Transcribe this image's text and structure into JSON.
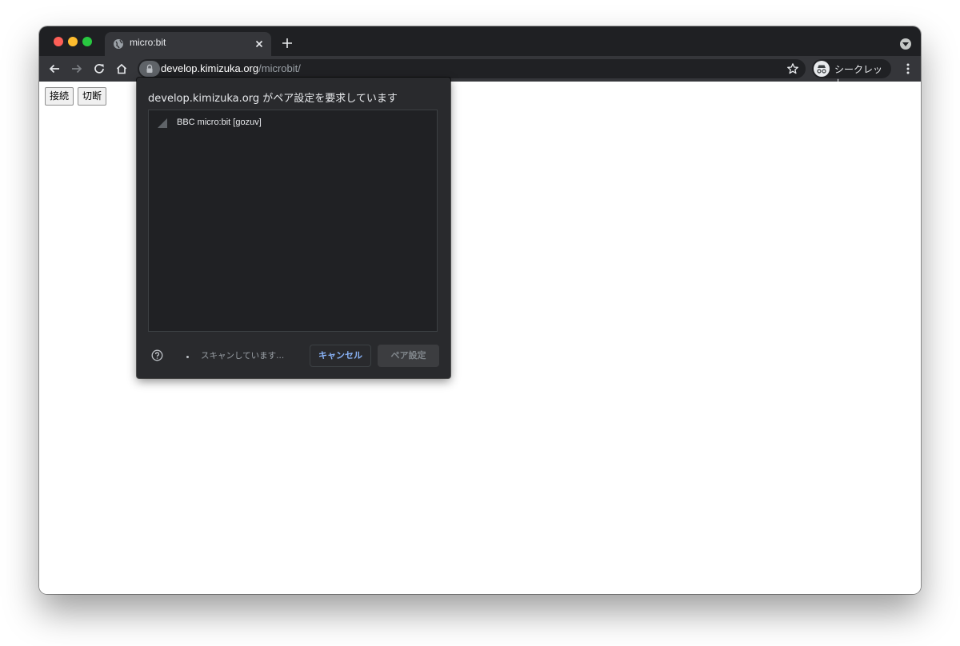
{
  "tab": {
    "title": "micro:bit"
  },
  "address_bar": {
    "host": "develop.kimizuka.org",
    "path": "/microbit/"
  },
  "profile": {
    "label": "シークレット"
  },
  "page": {
    "buttons": {
      "connect": "接続",
      "disconnect": "切断"
    }
  },
  "bluetooth_dialog": {
    "title": "develop.kimizuka.org がペア設定を要求しています",
    "devices": [
      {
        "name": "BBC micro:bit [gozuv]"
      }
    ],
    "status": "スキャンしています...",
    "cancel_label": "キャンセル",
    "pair_label": "ペア設定"
  },
  "colors": {
    "frame": "#1f2023",
    "toolbar": "#35363a",
    "dialog_bg": "#292a2d",
    "accent_link": "#8ab4f8"
  },
  "icons": [
    "globe-icon",
    "close-icon",
    "plus-icon",
    "back-icon",
    "forward-icon",
    "reload-icon",
    "home-icon",
    "lock-icon",
    "star-icon",
    "incognito-icon",
    "more-icon",
    "signal-icon",
    "help-icon",
    "spinner-icon"
  ]
}
